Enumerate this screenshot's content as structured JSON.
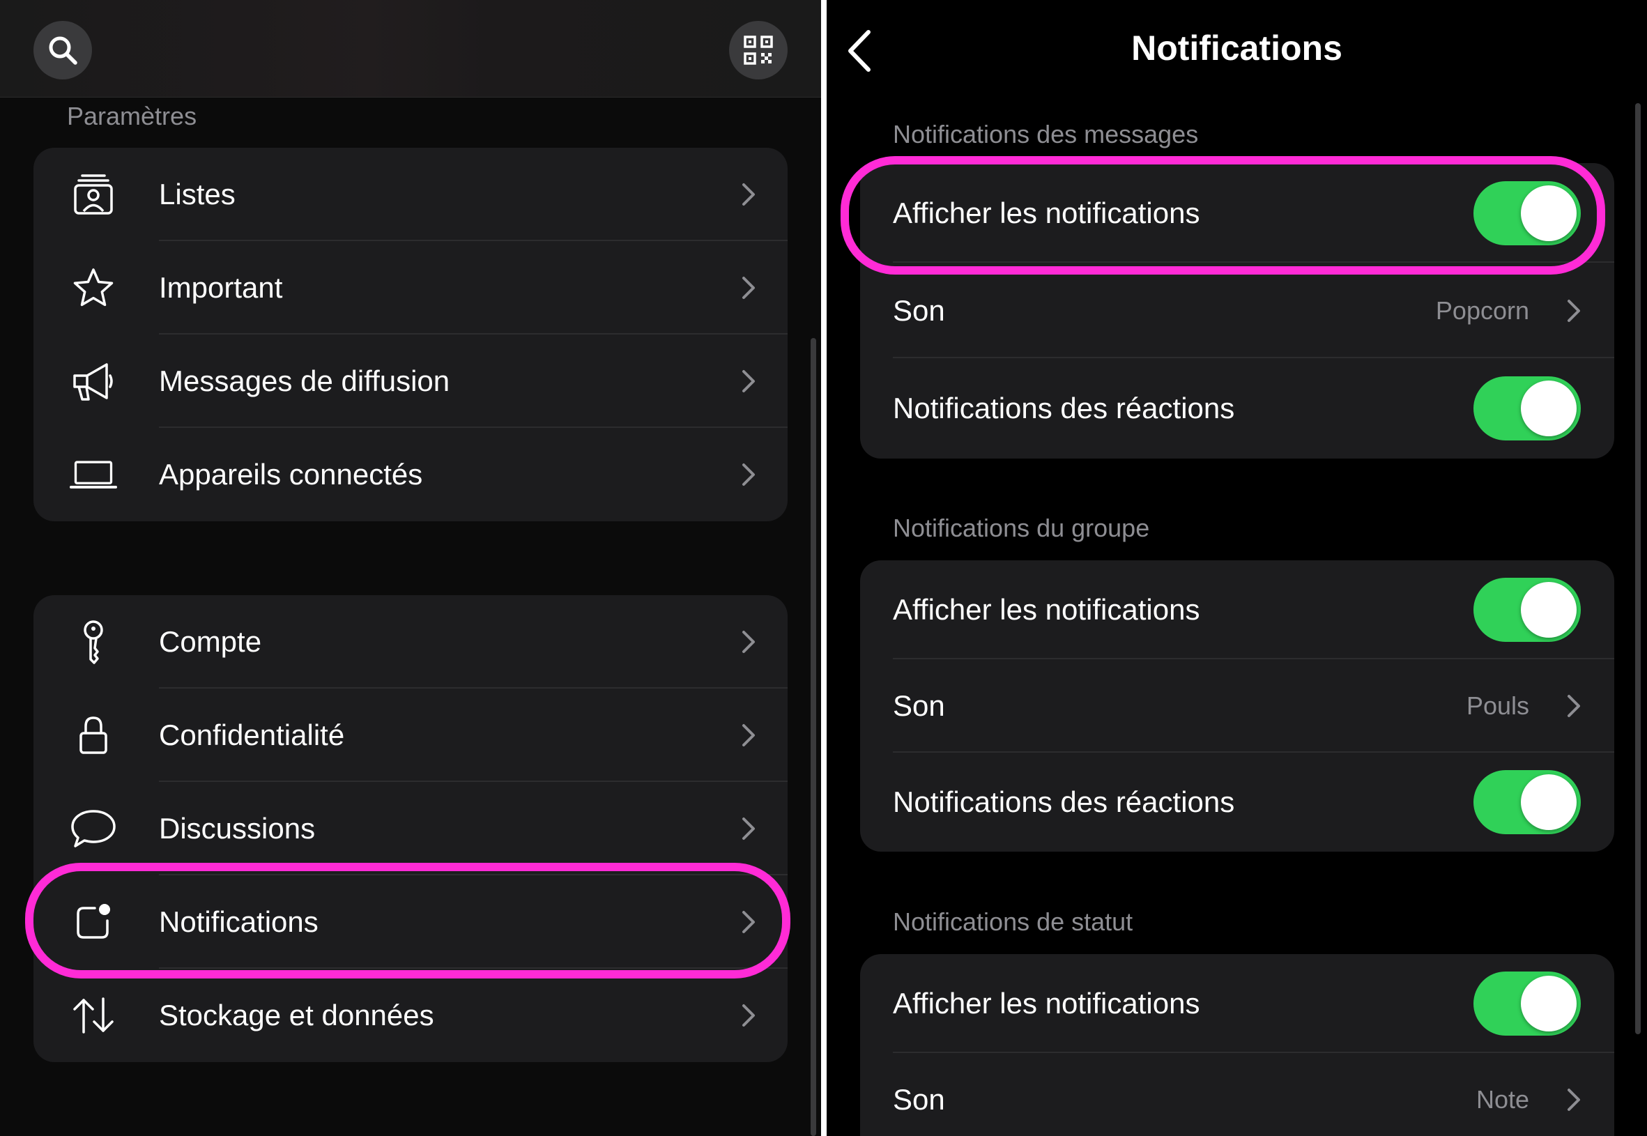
{
  "left": {
    "section_title": "Paramètres",
    "group1": [
      {
        "label": "Listes",
        "icon": "contact-list-icon"
      },
      {
        "label": "Important",
        "icon": "star-icon"
      },
      {
        "label": "Messages de diffusion",
        "icon": "megaphone-icon"
      },
      {
        "label": "Appareils connectés",
        "icon": "laptop-icon"
      }
    ],
    "group2": [
      {
        "label": "Compte",
        "icon": "key-icon"
      },
      {
        "label": "Confidentialité",
        "icon": "lock-icon"
      },
      {
        "label": "Discussions",
        "icon": "chat-bubble-icon"
      },
      {
        "label": "Notifications",
        "icon": "notification-badge-icon"
      },
      {
        "label": "Stockage et données",
        "icon": "up-down-arrows-icon"
      }
    ],
    "top_icons": {
      "search": "search-icon",
      "qr": "qr-code-icon"
    }
  },
  "right": {
    "title": "Notifications",
    "sections": [
      {
        "label": "Notifications des messages",
        "rows": [
          {
            "label": "Afficher les notifications",
            "toggle": true
          },
          {
            "label": "Son",
            "value": "Popcorn"
          },
          {
            "label": "Notifications des réactions",
            "toggle": true
          }
        ]
      },
      {
        "label": "Notifications du groupe",
        "rows": [
          {
            "label": "Afficher les notifications",
            "toggle": true
          },
          {
            "label": "Son",
            "value": "Pouls"
          },
          {
            "label": "Notifications des réactions",
            "toggle": true
          }
        ]
      },
      {
        "label": "Notifications de statut",
        "rows": [
          {
            "label": "Afficher les notifications",
            "toggle": true
          },
          {
            "label": "Son",
            "value": "Note"
          }
        ]
      }
    ]
  },
  "colors": {
    "toggle_on": "#30d158",
    "highlight": "#ff2bd6",
    "card_bg": "#1c1c1e",
    "secondary_text": "#8e8e93"
  }
}
